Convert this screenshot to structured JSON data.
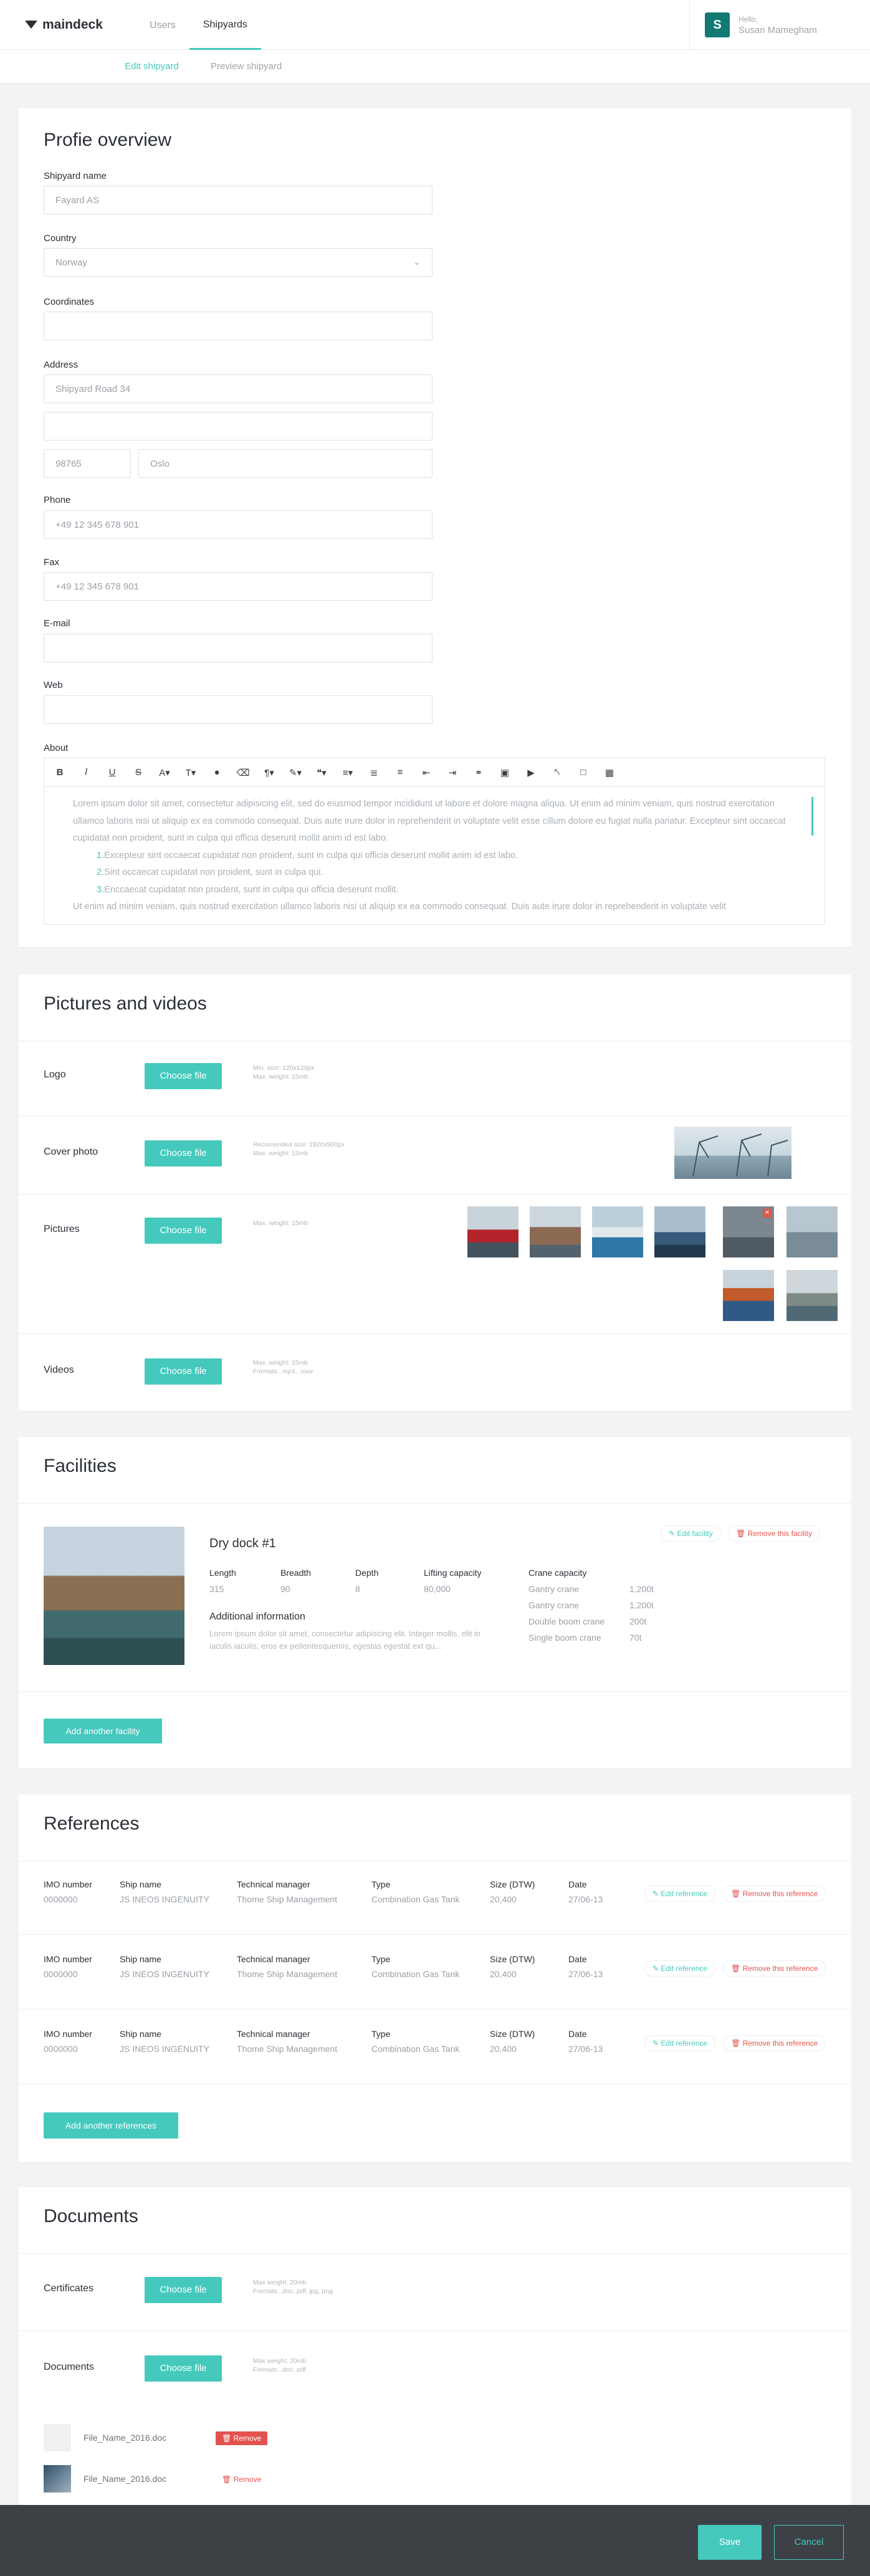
{
  "brand": {
    "name": "maindeck",
    "accent": "#45c9bd",
    "danger": "#e2534f"
  },
  "nav": {
    "items": [
      "Users",
      "Shipyards"
    ],
    "active": "Shipyards"
  },
  "user": {
    "avatar_letter": "S",
    "hello": "Hello,",
    "name": "Susan Mamegham"
  },
  "subnav": {
    "edit": "Edit shipyard",
    "preview": "Preview shipyard"
  },
  "profile": {
    "title": "Profie overview",
    "shipyard_name_label": "Shipyard name",
    "shipyard_name_value": "Fayard AS",
    "country_label": "Country",
    "country_value": "Norway",
    "coordinates_label": "Coordinates",
    "coordinates_value": "",
    "address_label": "Address",
    "address_line1": "Shipyard Road 34",
    "address_line2": "",
    "zip": "98765",
    "city": "Oslo",
    "phone_label": "Phone",
    "phone_value": "+49 12 345 678 901",
    "fax_label": "Fax",
    "fax_value": "+49 12 345 678 901",
    "email_label": "E-mail",
    "email_value": "",
    "web_label": "Web",
    "web_value": "",
    "about_label": "About",
    "about_p1": "Lorem ipsum dolor sit amet, consectetur adipisicing elit, sed do eiusmod tempor incididunt ut labore et dolore magna aliqua. Ut enim ad minim veniam, quis nostrud exercitation ullamco laboris nisi ut aliquip ex ea commodo consequat. Duis aute irure dolor in reprehenderit in voluptate velit esse cillum dolore eu fugiat nulla pariatur. Excepteur sint occaecat cupidatat non proident, sunt in culpa qui officia deserunt mollit anim id est labo.",
    "about_list": [
      {
        "n": "1.",
        "t": "Excepteur sint occaecat cupidatat non proident, sunt in culpa qui officia deserunt mollit anim id est labo."
      },
      {
        "n": "2.",
        "t": "Sint occaecat cupidatat non proident, sunt in culpa qui."
      },
      {
        "n": "3.",
        "t": "Enccaecat cupidatat non proident, sunt in culpa qui officia deserunt mollit."
      }
    ],
    "about_p2": "Ut enim ad minim veniam, quis nostrud exercitation ullamco laboris nisi ut aliquip ex ea commodo consequat. Duis aute irure dolor in reprehenderit in voluptate velit"
  },
  "media": {
    "title": "Pictures and videos",
    "choose": "Choose file",
    "logo_label": "Logo",
    "logo_hint1": "Min. size: 120x120px",
    "logo_hint2": "Max. weight: 15mb",
    "cover_label": "Cover photo",
    "cover_hint1": "Recomended size: 1920x900px",
    "cover_hint2": "Max. weight: 15mb",
    "pictures_label": "Pictures",
    "pictures_hint": "Max. weight: 15mb",
    "videos_label": "Videos",
    "videos_hint1": "Max. weight: 15mb",
    "videos_hint2": "Formats: .mp4, .mov"
  },
  "facilities": {
    "title": "Facilities",
    "name": "Dry dock #1",
    "edit": "Edit facility",
    "remove": "Remove this facility",
    "headers": [
      "Length",
      "Breadth",
      "Depth",
      "Lifting capacity"
    ],
    "values": [
      "315",
      "90",
      "8",
      "80,000"
    ],
    "crane_label": "Crane capacity",
    "cranes": [
      {
        "name": "Gantry crane",
        "cap": "1,200t"
      },
      {
        "name": "Gantry crane",
        "cap": "1,200t"
      },
      {
        "name": "Double boom crane",
        "cap": "200t"
      },
      {
        "name": "Single boom crane",
        "cap": "70t"
      }
    ],
    "info_label": "Additional information",
    "info_text": "Lorem ipsum dolor sit amet, consectetur adipiscing elit. Integer mollis, elit in iaculis iaculis, eros ex pellentesquemis, egestas egestat ext qu...",
    "add": "Add another facility"
  },
  "references": {
    "title": "References",
    "headers": [
      "IMO number",
      "Ship name",
      "Technical manager",
      "Type",
      "Size (DTW)",
      "Date"
    ],
    "rows": [
      [
        "0000000",
        "JS INEOS INGENUITY",
        "Thome Ship Management",
        "Combination Gas Tank",
        "20,400",
        "27/06-13"
      ],
      [
        "0000000",
        "JS INEOS INGENUITY",
        "Thome Ship Management",
        "Combination Gas Tank",
        "20,400",
        "27/06-13"
      ],
      [
        "0000000",
        "JS INEOS INGENUITY",
        "Thome Ship Management",
        "Combination Gas Tank",
        "20,400",
        "27/06-13"
      ]
    ],
    "edit": "Edit reference",
    "remove": "Remove this reference",
    "add": "Add another references"
  },
  "documents": {
    "title": "Documents",
    "certificates_label": "Certificates",
    "certificates_hint1": "Max weight: 20mb",
    "certificates_hint2": "Formats: .doc, pdf, jpg, png",
    "documents_label": "Documents",
    "documents_hint1": "Max weight: 20mb",
    "documents_hint2": "Formats: .doc, pdf",
    "choose": "Choose file",
    "files": [
      {
        "name": "File_Name_2016.doc",
        "remove": "Remove"
      },
      {
        "name": "File_Name_2016.doc",
        "remove": "Remove"
      }
    ]
  },
  "footer": {
    "save": "Save",
    "cancel": "Cancel"
  }
}
